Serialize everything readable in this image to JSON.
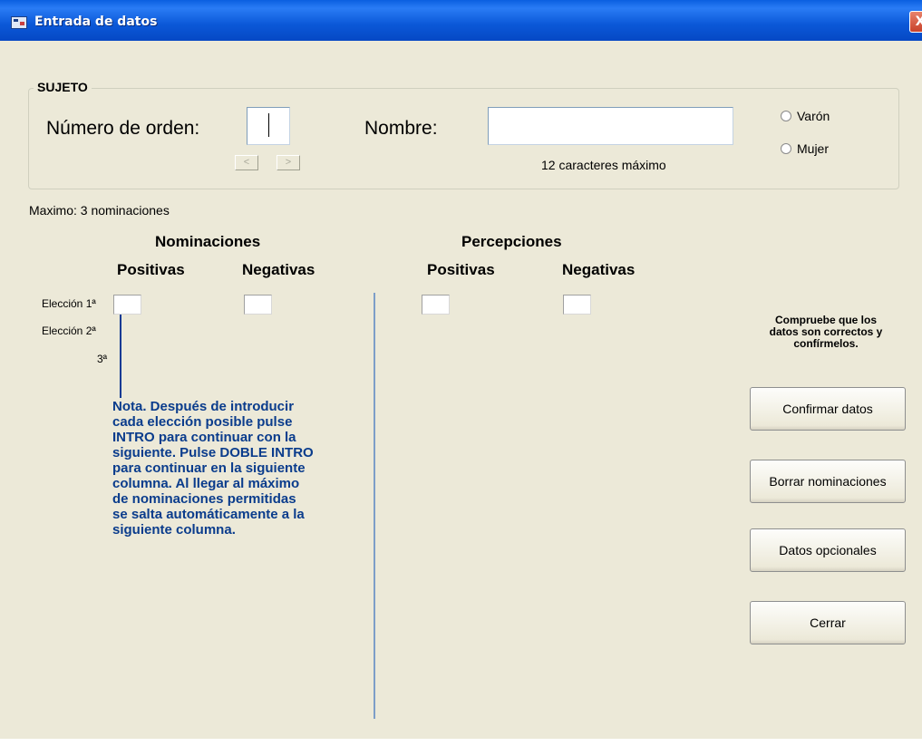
{
  "window": {
    "title": "Entrada de datos",
    "close_label": "X"
  },
  "sujeto": {
    "legend": "SUJETO",
    "numero_label": "Número de orden:",
    "numero_value": "",
    "prev_label": "<",
    "next_label": ">",
    "nombre_label": "Nombre:",
    "nombre_value": "",
    "nombre_hint": "12 caracteres máximo",
    "sexo_options": [
      "Varón",
      "Mujer"
    ]
  },
  "maximo_label": "Maximo:  3 nominaciones",
  "nominaciones": {
    "title": "Nominaciones",
    "positivas": "Positivas",
    "negativas": "Negativas"
  },
  "percepciones": {
    "title": "Percepciones",
    "positivas": "Positivas",
    "negativas": "Negativas"
  },
  "rows": {
    "eleccion1": "Elección 1ª",
    "eleccion2": "Elección 2ª",
    "eleccion3": "3ª"
  },
  "nota_lines": [
    "Nota. Después de introducir",
    "cada elección posible pulse",
    "INTRO para continuar con la",
    "siguiente. Pulse DOBLE INTRO",
    "para continuar en la siguiente",
    "columna. Al llegar al máximo",
    "de nominaciones permitidas",
    "se salta automáticamente a la",
    "siguiente columna."
  ],
  "hint_lines": [
    "Compruebe que los",
    "datos son correctos y",
    "confírmelos."
  ],
  "buttons": {
    "confirmar": "Confirmar datos",
    "borrar": "Borrar nominaciones",
    "opcionales": "Datos opcionales",
    "cerrar": "Cerrar"
  }
}
